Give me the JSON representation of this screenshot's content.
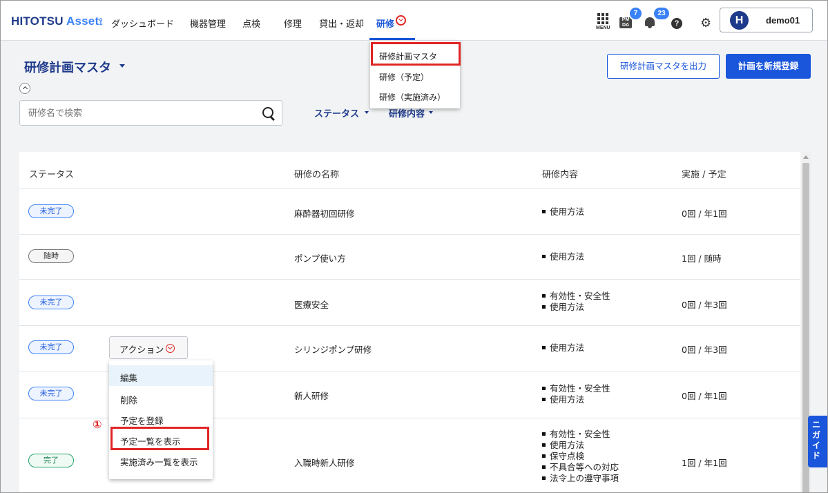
{
  "header": {
    "logo_main": "HITOTSU",
    "logo_asset": "Asset",
    "logo_mark": "⟟",
    "nav": [
      "ダッシュボード",
      "機器管理",
      "点検",
      "修理",
      "貸出・返却",
      "研修"
    ],
    "menu_label": "MENU",
    "pmda_label": "PM\nDA",
    "pmda_badge": "7",
    "notif_badge": "23",
    "help": "?",
    "gear": "⚙",
    "avatar_letter": "H",
    "username": "demo01"
  },
  "nav_dropdown": {
    "items": [
      "研修計画マスタ",
      "研修（予定）",
      "研修（実施済み）"
    ]
  },
  "page": {
    "title": "研修計画マスタ",
    "export_button": "研修計画マスタを出力",
    "new_button": "計画を新規登録",
    "search_placeholder": "研修名で検索",
    "filters": [
      "ステータス",
      "研修内容"
    ]
  },
  "table": {
    "headers": [
      "ステータス",
      "研修の名称",
      "研修内容",
      "実施 / 予定"
    ],
    "rows": [
      {
        "status": "未完了",
        "status_type": "blue",
        "name": "麻酔器初回研修",
        "contents": [
          "使用方法"
        ],
        "count": "0回 / 年1回"
      },
      {
        "status": "随時",
        "status_type": "gray",
        "name": "ポンプ使い方",
        "contents": [
          "使用方法"
        ],
        "count": "1回 / 随時"
      },
      {
        "status": "未完了",
        "status_type": "blue",
        "name": "医療安全",
        "contents": [
          "有効性・安全性",
          "使用方法"
        ],
        "count": "0回 / 年3回"
      },
      {
        "status": "未完了",
        "status_type": "blue",
        "name": "シリンジポンプ研修",
        "contents": [
          "使用方法"
        ],
        "count": "0回 / 年3回"
      },
      {
        "status": "未完了",
        "status_type": "blue",
        "name": "新人研修",
        "contents": [
          "有効性・安全性",
          "使用方法"
        ],
        "count": "0回 / 年1回"
      },
      {
        "status": "完了",
        "status_type": "green",
        "name": "入職時新人研修",
        "contents": [
          "有効性・安全性",
          "使用方法",
          "保守点検",
          "不具合等への対応",
          "法令上の遵守事項"
        ],
        "count": "1回 / 年1回"
      }
    ]
  },
  "action_menu": {
    "button": "アクション",
    "items": [
      "編集",
      "削除",
      "予定を登録",
      "予定一覧を表示",
      "実施済み一覧を表示"
    ]
  },
  "annotation": {
    "step": "①"
  },
  "guide": {
    "label": "ニガイド"
  },
  "colors": {
    "primary": "#1a56db",
    "navy": "#1e3a8a",
    "highlight": "#e02424"
  }
}
